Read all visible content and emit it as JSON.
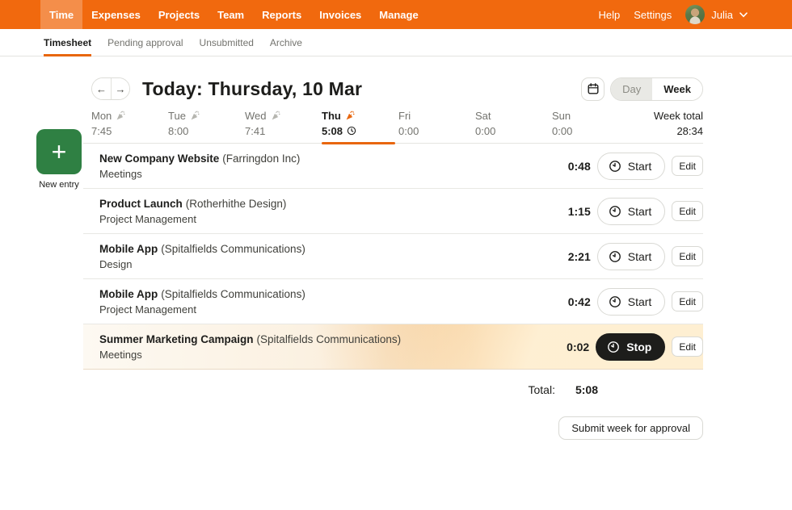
{
  "topnav": {
    "items": [
      {
        "label": "Time",
        "active": true
      },
      {
        "label": "Expenses"
      },
      {
        "label": "Projects"
      },
      {
        "label": "Team"
      },
      {
        "label": "Reports"
      },
      {
        "label": "Invoices"
      },
      {
        "label": "Manage"
      }
    ],
    "help": "Help",
    "settings": "Settings",
    "user": "Julia"
  },
  "tabs": [
    {
      "label": "Timesheet",
      "active": true
    },
    {
      "label": "Pending approval"
    },
    {
      "label": "Unsubmitted"
    },
    {
      "label": "Archive"
    }
  ],
  "header": {
    "prev": "←",
    "next": "→",
    "today_label": "Today:",
    "date": "Thursday, 10 Mar",
    "view_day": "Day",
    "view_week": "Week"
  },
  "new_entry": {
    "plus": "+",
    "label": "New entry"
  },
  "week": {
    "days": [
      {
        "name": "Mon",
        "time": "7:45",
        "flag": "gray"
      },
      {
        "name": "Tue",
        "time": "8:00",
        "flag": "gray"
      },
      {
        "name": "Wed",
        "time": "7:41",
        "flag": "gray"
      },
      {
        "name": "Thu",
        "time": "5:08",
        "flag": "orange",
        "active": true,
        "running": true
      },
      {
        "name": "Fri",
        "time": "0:00"
      },
      {
        "name": "Sat",
        "time": "0:00"
      },
      {
        "name": "Sun",
        "time": "0:00"
      }
    ],
    "total_label": "Week total",
    "total_value": "28:34"
  },
  "entries": [
    {
      "project": "New Company Website",
      "client": "(Farringdon Inc)",
      "task": "Meetings",
      "time": "0:48",
      "timer_label": "Start",
      "edit_label": "Edit"
    },
    {
      "project": "Product Launch",
      "client": "(Rotherhithe Design)",
      "task": "Project Management",
      "time": "1:15",
      "timer_label": "Start",
      "edit_label": "Edit"
    },
    {
      "project": "Mobile App",
      "client": "(Spitalfields Communications)",
      "task": "Design",
      "time": "2:21",
      "timer_label": "Start",
      "edit_label": "Edit"
    },
    {
      "project": "Mobile App",
      "client": "(Spitalfields Communications)",
      "task": "Project Management",
      "time": "0:42",
      "timer_label": "Start",
      "edit_label": "Edit"
    },
    {
      "project": "Summer Marketing Campaign",
      "client": "(Spitalfields Communications)",
      "task": "Meetings",
      "time": "0:02",
      "timer_label": "Stop",
      "edit_label": "Edit",
      "running": true
    }
  ],
  "summary": {
    "total_label": "Total:",
    "total_value": "5:08"
  },
  "submit_label": "Submit week for approval",
  "colors": {
    "brand_orange": "#f1690e",
    "accent_orange": "#e8660d",
    "new_entry_green": "#2f8043",
    "stop_button": "#1d1d1b",
    "text_dark": "#1d1d1b",
    "text_gray": "#73736e"
  }
}
